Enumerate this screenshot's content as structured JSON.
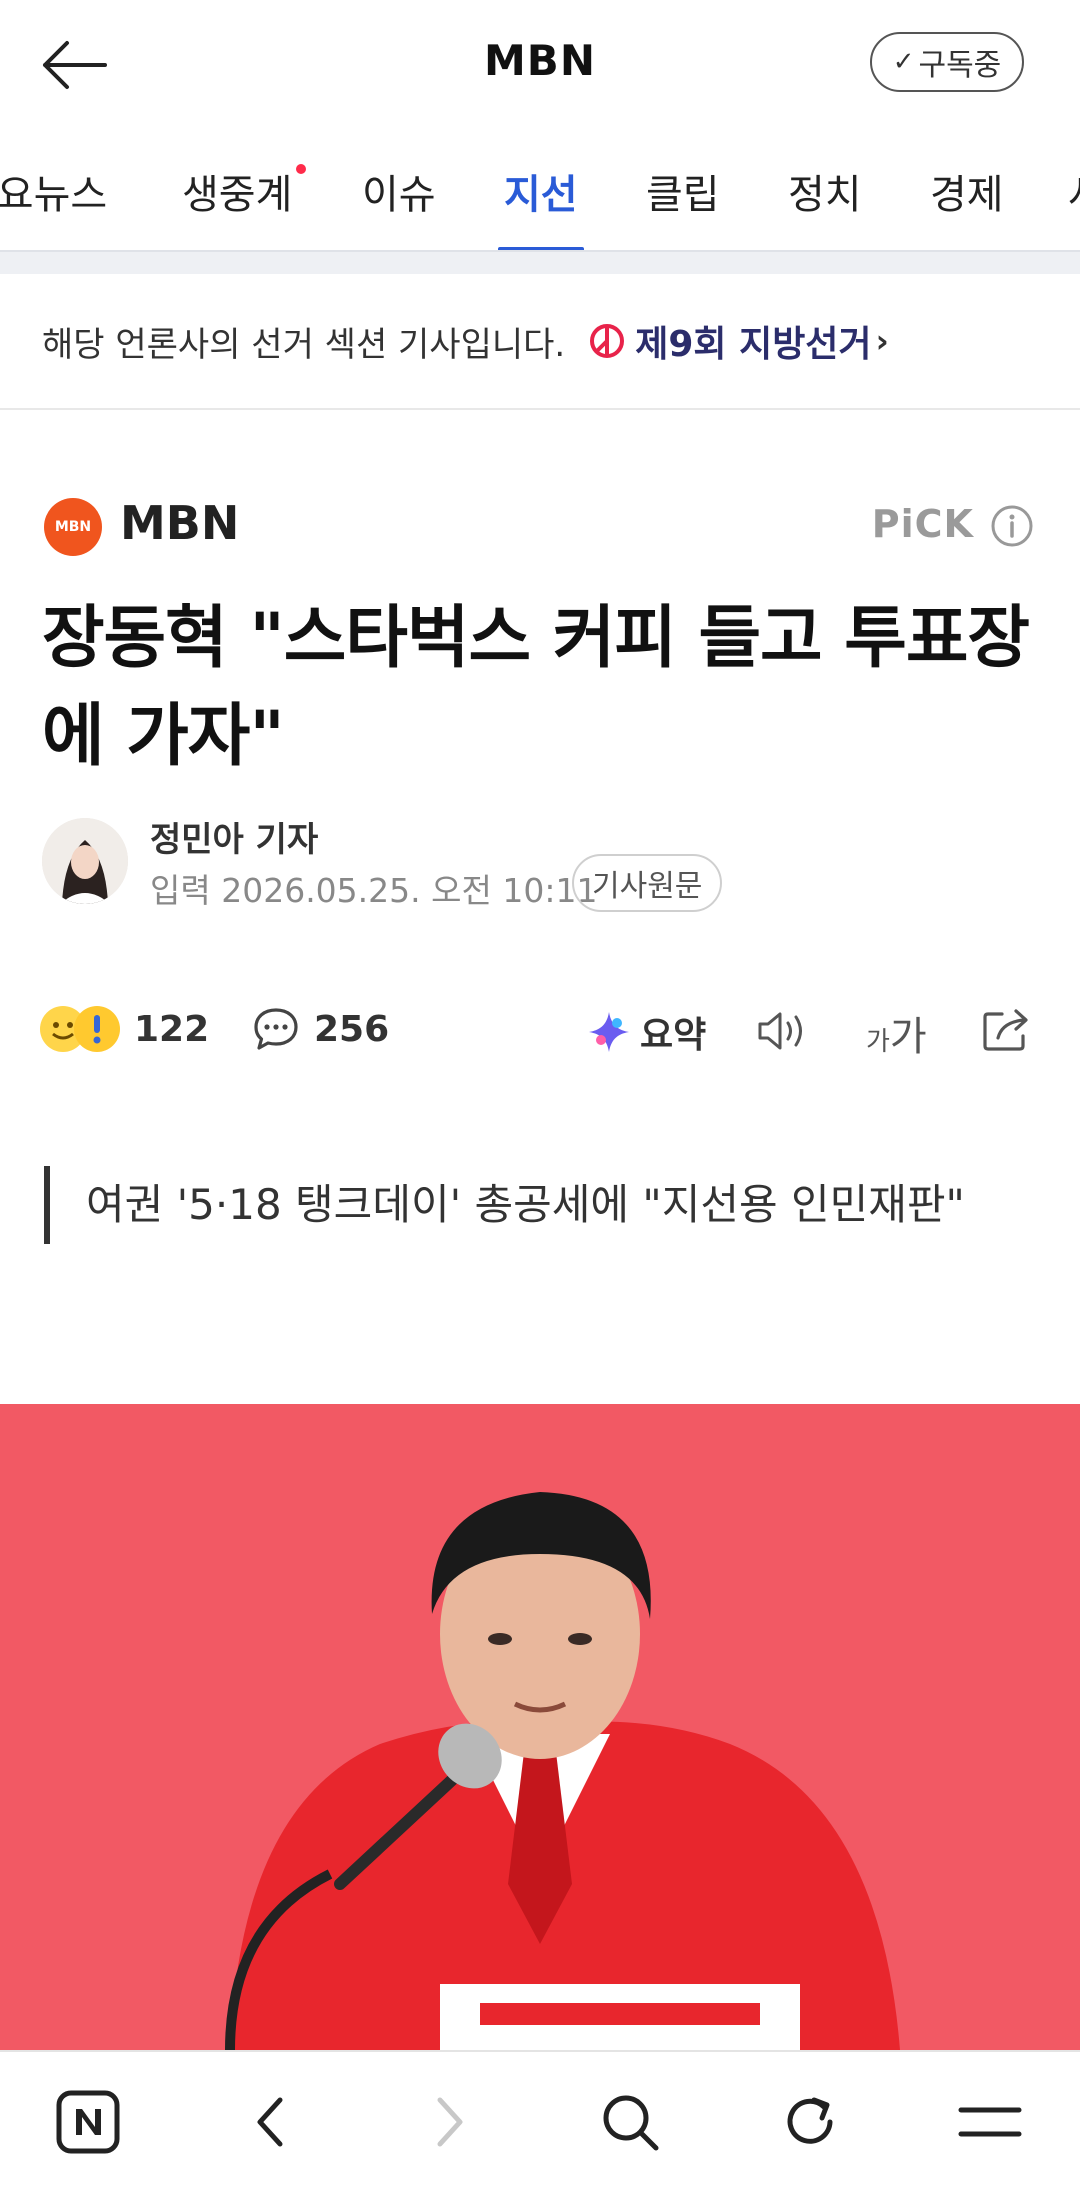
{
  "header": {
    "title": "MBN",
    "subscribe_label": "구독중"
  },
  "tabs": [
    {
      "label": "주요뉴스"
    },
    {
      "label": "생중계"
    },
    {
      "label": "이슈"
    },
    {
      "label": "지선"
    },
    {
      "label": "클립"
    },
    {
      "label": "정치"
    },
    {
      "label": "경제"
    },
    {
      "label": "사"
    }
  ],
  "election_banner": {
    "text": "해당 언론사의 선거 섹션 기사입니다.",
    "link_label": "제9회 지방선거"
  },
  "press": {
    "name": "MBN",
    "logo_text": "MBN",
    "pick_label": "PiCK"
  },
  "article": {
    "headline": "장동혁 \"스타벅스 커피 들고 투표장에 가자\"",
    "reporter": "정민아 기자",
    "date": "입력 2026.05.25. 오전 10:11",
    "original_label": "기사원문",
    "subquote": "여권 '5·18 탱크데이' 총공세에 \"지선용 인민재판\""
  },
  "actions": {
    "reaction_count": "122",
    "comment_count": "256",
    "summary_label": "요약",
    "font_small": "가",
    "font_big": "가"
  },
  "colors": {
    "accent": "#2a5bd7",
    "press_logo": "#f0551e",
    "photo_background": "#f2545f",
    "jacket": "#e8262d"
  }
}
